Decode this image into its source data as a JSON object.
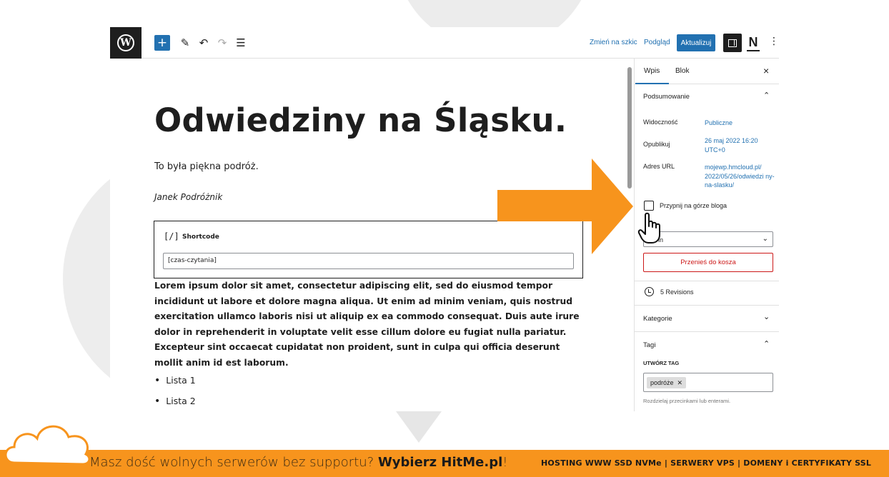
{
  "toolbar": {
    "add_icon": "plus-icon",
    "tools_icon": "pencil-icon",
    "undo_icon": "undo-icon",
    "redo_icon": "redo-icon",
    "outline_icon": "list-view-icon",
    "switch_draft": "Zmień na szkic",
    "preview": "Podgląd",
    "update": "Aktualizuj",
    "more_icon": "⋮"
  },
  "post": {
    "title": "Odwiedziny na Śląsku.",
    "paragraph": "To była piękna podróż.",
    "author_line": "Janek Podróżnik",
    "shortcode_block": {
      "icon": "[/]",
      "label": "Shortcode",
      "value": "[czas-czytania]"
    },
    "lorem": "Lorem ipsum dolor sit amet, consectetur adipiscing elit, sed do eiusmod tempor incididunt ut labore et dolore magna aliqua. Ut enim ad minim veniam, quis nostrud exercitation ullamco laboris nisi ut aliquip ex ea commodo consequat. Duis aute irure dolor in reprehenderit in voluptate velit esse cillum dolore eu fugiat nulla pariatur. Excepteur sint occaecat cupidatat non proident, sunt in culpa qui officia deserunt mollit anim id est laborum.",
    "list": [
      "Lista 1",
      "Lista 2"
    ]
  },
  "sidebar": {
    "tabs": [
      "Wpis",
      "Blok"
    ],
    "close": "×",
    "summary": {
      "title": "Podsumowanie",
      "visibility_label": "Widoczność",
      "visibility_value": "Publiczne",
      "publish_label": "Opublikuj",
      "publish_value": "26 maj 2022 16:20 UTC+0",
      "url_label": "Adres URL",
      "url_value": "mojewp.hmcloud.pl/ 2022/05/26/odwiedzi ny-na-slasku/",
      "pin_label": "Przypnij na górze bloga",
      "pin_checked": false,
      "author_value": "in",
      "trash": "Przenieś do kosza"
    },
    "revisions": "5 Revisions",
    "categories": "Kategorie",
    "tags": {
      "title": "Tagi",
      "add_label": "UTWÓRZ TAG",
      "chip": "podróże",
      "chip_remove": "✕",
      "help": "Rozdzielaj przecinkami lub enterami."
    }
  },
  "overlay": {
    "arrow_color": "#f7941d",
    "cursor_icon": "hand-pointer-icon"
  },
  "footer": {
    "lead": "Masz dość wolnych serwerów bez supportu? ",
    "brand": "Wybierz HitMe.pl",
    "bang": "!",
    "services": "HOSTING WWW SSD NVMe | SERWERY VPS | DOMENY i CERTYFIKATY SSL",
    "accent_color": "#f7941d"
  }
}
